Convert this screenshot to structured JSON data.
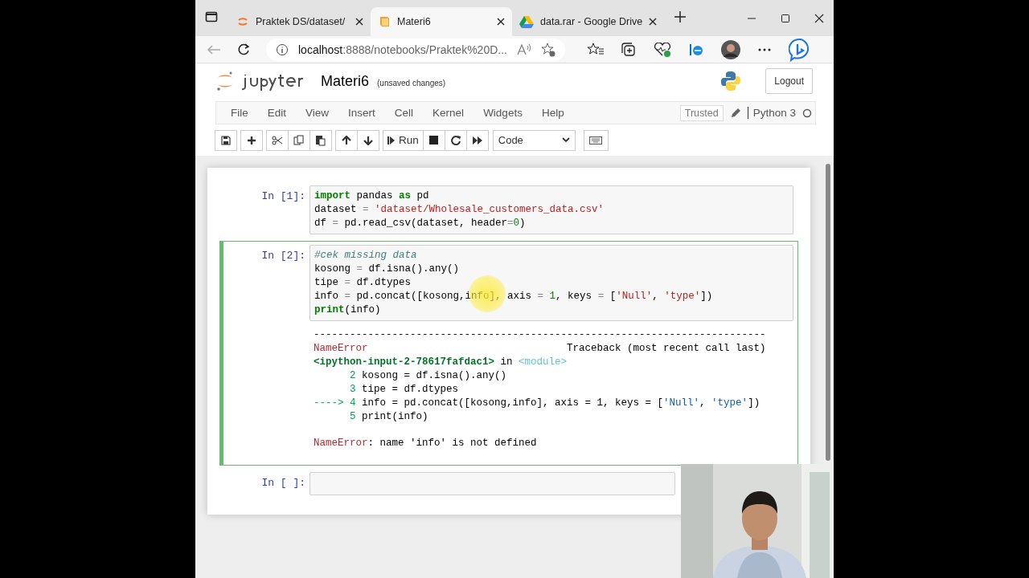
{
  "browser": {
    "tabs": [
      {
        "title": "Praktek DS/dataset/",
        "selected": false
      },
      {
        "title": "Materi6",
        "selected": true
      },
      {
        "title": "data.rar - Google Drive",
        "selected": false
      }
    ],
    "address": {
      "host": "localhost",
      "path": ":8888/notebooks/Praktek%20D..."
    }
  },
  "header": {
    "notebook_name": "Materi6",
    "save_status": "(unsaved changes)",
    "logout": "Logout"
  },
  "menubar": {
    "menus": [
      "File",
      "Edit",
      "View",
      "Insert",
      "Cell",
      "Kernel",
      "Widgets",
      "Help"
    ],
    "trusted": "Trusted",
    "kernel": "Python 3"
  },
  "toolbar": {
    "run": "Run",
    "cell_type": "Code"
  },
  "cells": [
    {
      "prompt": "In [1]:",
      "selected": false,
      "input": [
        [
          {
            "kind": "kw",
            "text": "import"
          },
          {
            "kind": "plain",
            "text": " pandas "
          },
          {
            "kind": "kw",
            "text": "as"
          },
          {
            "kind": "plain",
            "text": " pd"
          }
        ],
        [
          {
            "kind": "plain",
            "text": "dataset "
          },
          {
            "kind": "op",
            "text": "= "
          },
          {
            "kind": "str",
            "text": "'dataset/Wholesale_customers_data.csv'"
          }
        ],
        [
          {
            "kind": "plain",
            "text": "df "
          },
          {
            "kind": "op",
            "text": "="
          },
          {
            "kind": "plain",
            "text": " pd.read_csv(dataset, header"
          },
          {
            "kind": "op",
            "text": "="
          },
          {
            "kind": "num",
            "text": "0"
          },
          {
            "kind": "plain",
            "text": ")"
          }
        ]
      ]
    },
    {
      "prompt": "In [2]:",
      "selected": true,
      "input": [
        [
          {
            "kind": "comment",
            "text": "#cek missing data"
          }
        ],
        [
          {
            "kind": "plain",
            "text": "kosong "
          },
          {
            "kind": "op",
            "text": "="
          },
          {
            "kind": "plain",
            "text": " df.isna().any()"
          }
        ],
        [
          {
            "kind": "plain",
            "text": "tipe "
          },
          {
            "kind": "op",
            "text": "="
          },
          {
            "kind": "plain",
            "text": " df.dtypes"
          }
        ],
        [
          {
            "kind": "plain",
            "text": "info "
          },
          {
            "kind": "op",
            "text": "="
          },
          {
            "kind": "plain",
            "text": " pd.concat([kosong,info], axis "
          },
          {
            "kind": "op",
            "text": "= "
          },
          {
            "kind": "num",
            "text": "1"
          },
          {
            "kind": "plain",
            "text": ", keys "
          },
          {
            "kind": "op",
            "text": "="
          },
          {
            "kind": "plain",
            "text": " ["
          },
          {
            "kind": "str",
            "text": "'Null'"
          },
          {
            "kind": "plain",
            "text": ", "
          },
          {
            "kind": "str",
            "text": "'type'"
          },
          {
            "kind": "plain",
            "text": "])"
          }
        ],
        [
          {
            "kind": "kw",
            "text": "print"
          },
          {
            "kind": "plain",
            "text": "(info)"
          }
        ]
      ],
      "output": {
        "traceback": [
          [
            {
              "kind": "plain",
              "text": "---------------------------------------------------------------------------"
            }
          ],
          [
            {
              "kind": "err",
              "text": "NameError"
            },
            {
              "kind": "plain",
              "text": "                                 Traceback (most recent call last)"
            }
          ],
          [
            {
              "kind": "ipy",
              "text": "<ipython-input-2-78617fafdac1>"
            },
            {
              "kind": "plain",
              "text": " in "
            },
            {
              "kind": "mod",
              "text": "<module>"
            }
          ],
          [
            {
              "kind": "lineno",
              "text": "      2"
            },
            {
              "kind": "plain",
              "text": " kosong = df.isna().any()"
            }
          ],
          [
            {
              "kind": "lineno",
              "text": "      3"
            },
            {
              "kind": "plain",
              "text": " tipe = df.dtypes"
            }
          ],
          [
            {
              "kind": "lineno",
              "text": "----> 4"
            },
            {
              "kind": "plain",
              "text": " info = pd.concat([kosong,info], axis = 1, keys = ["
            },
            {
              "kind": "ostr",
              "text": "'Null'"
            },
            {
              "kind": "plain",
              "text": ", "
            },
            {
              "kind": "ostr",
              "text": "'type'"
            },
            {
              "kind": "plain",
              "text": "])"
            }
          ],
          [
            {
              "kind": "lineno",
              "text": "      5"
            },
            {
              "kind": "plain",
              "text": " print(info)"
            }
          ]
        ],
        "message": [
          {
            "kind": "err",
            "text": "NameError"
          },
          {
            "kind": "plain",
            "text": ": name 'info' is not defined"
          }
        ]
      }
    },
    {
      "prompt": "In [ ]:",
      "selected": false
    }
  ]
}
